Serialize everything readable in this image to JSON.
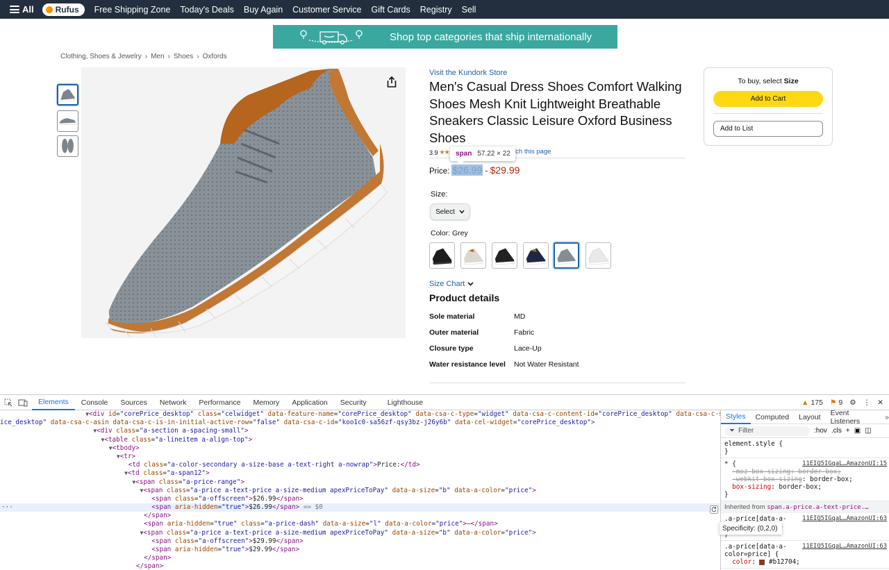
{
  "topnav": {
    "all_label": "All",
    "rufus_label": "Rufus",
    "links": [
      "Free Shipping Zone",
      "Today's Deals",
      "Buy Again",
      "Customer Service",
      "Gift Cards",
      "Registry",
      "Sell"
    ]
  },
  "banner": {
    "text": "Shop top categories that ship internationally"
  },
  "breadcrumb": [
    "Clothing, Shoes & Jewelry",
    "Men",
    "Shoes",
    "Oxfords"
  ],
  "breadcrumb_sep": "›",
  "product": {
    "store_link": "Visit the Kundork Store",
    "title": "Men's Casual Dress Shoes Comfort Walking Shoes Mesh Knit Lightweight Breathable Sneakers Classic Leisure Oxford Business Shoes",
    "rating": "3.9",
    "search_link_fragment": "rch this page",
    "price_label": "Price:",
    "price_low": "$26.99",
    "price_dash": "-",
    "price_high": "$29.99",
    "size_label": "Size:",
    "size_select": "Select",
    "color_label": "Color:",
    "color_value": "Grey",
    "size_chart": "Size Chart",
    "details_heading": "Product details",
    "details": [
      {
        "k": "Sole material",
        "v": "MD"
      },
      {
        "k": "Outer material",
        "v": "Fabric"
      },
      {
        "k": "Closure type",
        "v": "Lace-Up"
      },
      {
        "k": "Water resistance level",
        "v": "Not Water Resistant"
      }
    ]
  },
  "tooltip": {
    "tag": "span",
    "dims": "57.22 × 22"
  },
  "buybox": {
    "to_buy_prefix": "To buy, select",
    "to_buy_bold": "Size",
    "add_to_cart": "Add to Cart",
    "add_to_list": "Add to List"
  },
  "devtools": {
    "tabs": [
      "Elements",
      "Console",
      "Sources",
      "Network",
      "Performance",
      "Memory",
      "Application",
      "Security",
      "Lighthouse"
    ],
    "active_tab": "Elements",
    "warnings": "175",
    "issues": "9",
    "styles_tabs": [
      "Styles",
      "Computed",
      "Layout",
      "Event Listeners"
    ],
    "filter_placeholder": "Filter",
    "filter_toggles": [
      ":hov",
      ".cls"
    ],
    "selected_marker": "== $0",
    "specificity": "Specificity: (0,2,0)",
    "inherited_label": "Inherited from",
    "inherited_selector": "span.a-price.a-text-price.…",
    "source_file": "11EIQ5IGqaL…AmazonUI"
  },
  "colors": {
    "nav_bg": "#232f3e",
    "banner_bg": "#3aa89f",
    "link": "#2162a1",
    "price": "#b12704",
    "cart_button": "#ffd814",
    "devtools_accent": "#1a73e8"
  }
}
